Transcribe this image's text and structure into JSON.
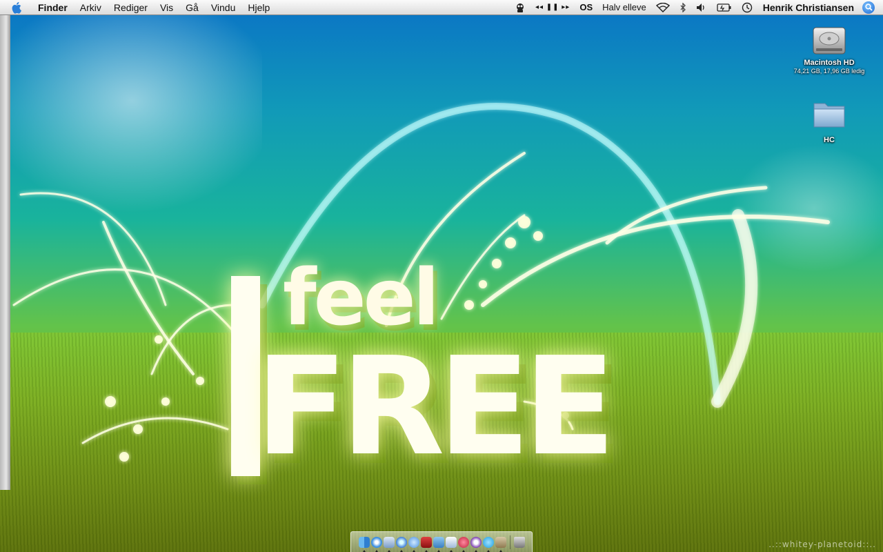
{
  "menubar": {
    "app_name": "Finder",
    "menus": [
      "Arkiv",
      "Rediger",
      "Vis",
      "Gå",
      "Vindu",
      "Hjelp"
    ],
    "clock": "Halv elleve",
    "user_name": "Henrik Christiansen",
    "media_controls": "◂◂ ❚❚ ▸▸",
    "extra_logo": "OS"
  },
  "desktop": {
    "icons": [
      {
        "label": "Macintosh HD",
        "detail": "74,21 GB, 17,96 GB ledig"
      },
      {
        "label": "HC"
      }
    ]
  },
  "wallpaper": {
    "line1": "feel",
    "line2": "FREE",
    "credit": "..::whitey-planetoid::.."
  },
  "dock": {
    "items": [
      "finder-icon",
      "safari-icon",
      "mail-icon",
      "itunes-icon",
      "ichat-icon",
      "stamp-icon",
      "iphoto-icon",
      "upload-icon",
      "cs-icon",
      "podcast-icon",
      "skype-icon",
      "box-icon",
      "trash-icon"
    ]
  }
}
